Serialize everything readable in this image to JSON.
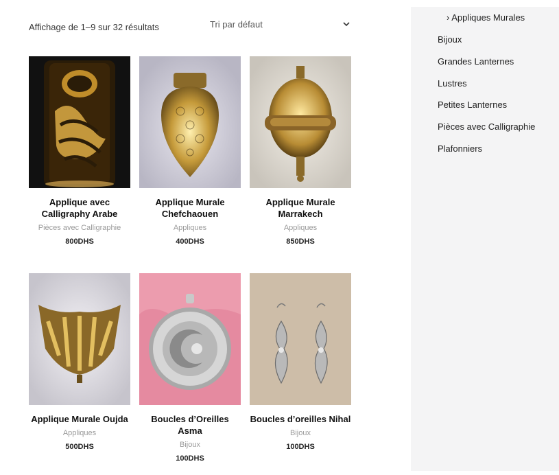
{
  "toolbar": {
    "result_count": "Affichage de 1–9 sur 32 résultats",
    "sort_label": "Tri par défaut"
  },
  "products": [
    {
      "title_line1": "Applique avec",
      "title_line2": "Calligraphy Arabe",
      "category": "Pièces avec Calligraphie",
      "price": "800DHS"
    },
    {
      "title_line1": "Applique Murale",
      "title_line2": "Chefchaouen",
      "category": "Appliques",
      "price": "400DHS"
    },
    {
      "title_line1": "Applique Murale",
      "title_line2": "Marrakech",
      "category": "Appliques",
      "price": "850DHS"
    },
    {
      "title_line1": "Applique Murale Oujda",
      "title_line2": "",
      "category": "Appliques",
      "price": "500DHS"
    },
    {
      "title_line1": "Boucles d’Oreilles Asma",
      "title_line2": "",
      "category": "Bijoux",
      "price": "100DHS"
    },
    {
      "title_line1": "Boucles d’oreilles Nihal",
      "title_line2": "",
      "category": "Bijoux",
      "price": "100DHS"
    }
  ],
  "sidebar": {
    "items": [
      {
        "label": "› Appliques Murales"
      },
      {
        "label": "Bijoux"
      },
      {
        "label": "Grandes Lanternes"
      },
      {
        "label": "Lustres"
      },
      {
        "label": "Petites Lanternes"
      },
      {
        "label": "Pièces avec Calligraphie"
      },
      {
        "label": "Plafonniers"
      }
    ]
  },
  "colors": {
    "sidebar_bg": "#f4f4f5",
    "category_text": "#9a9a9a",
    "brass": "#c9a24a"
  },
  "icons": {
    "sort": "chevron-down-icon"
  }
}
